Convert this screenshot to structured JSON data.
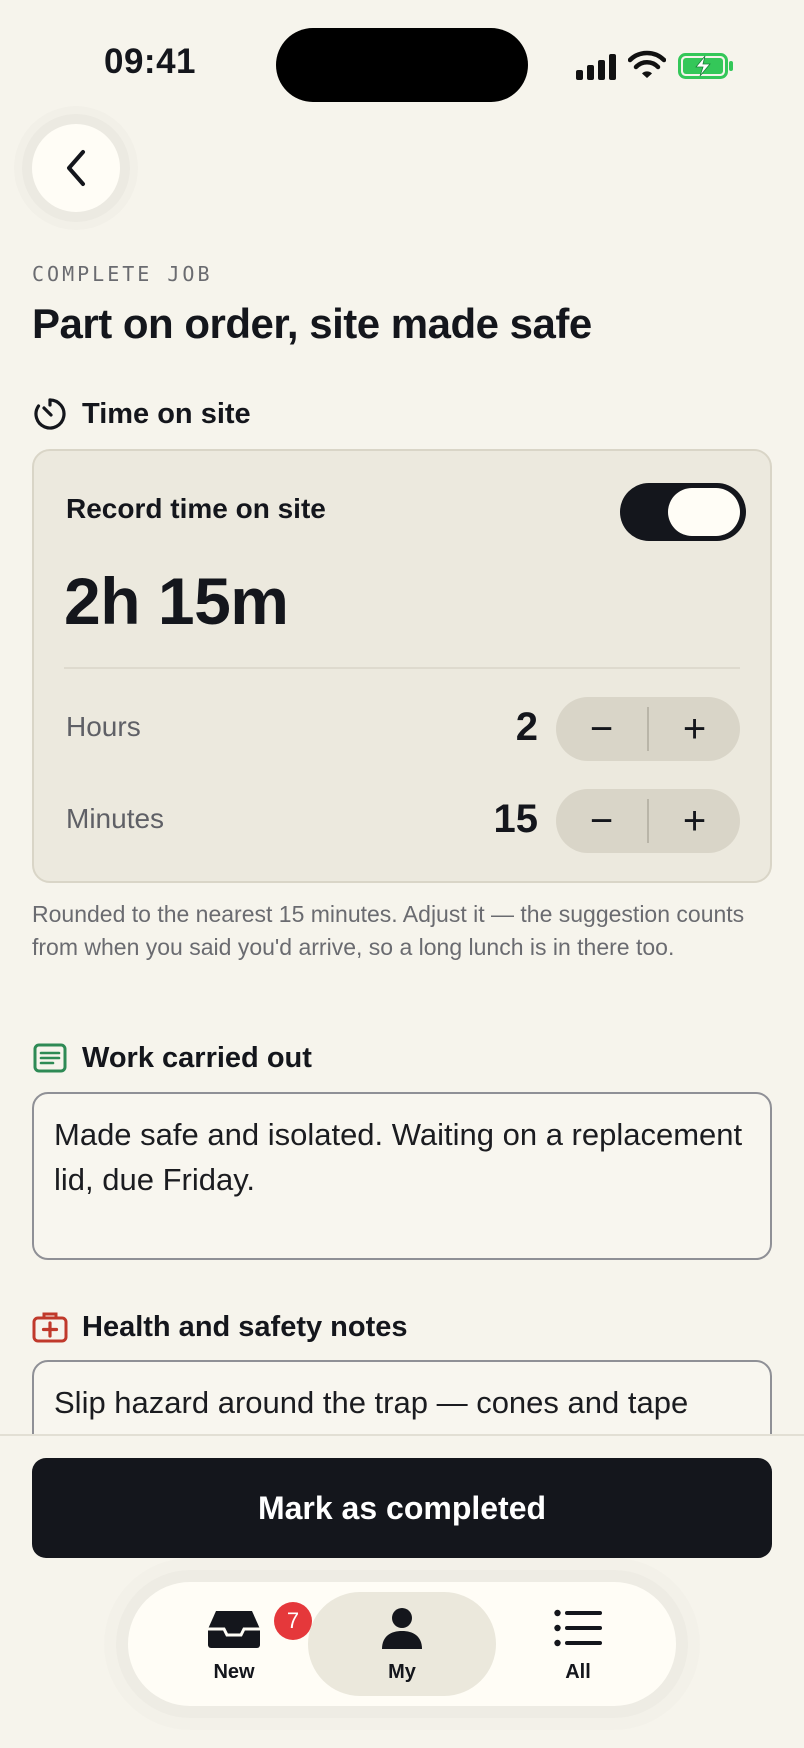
{
  "status_bar": {
    "time": "09:41"
  },
  "header": {
    "eyebrow": "COMPLETE JOB",
    "title": "Part on order, site made safe"
  },
  "time_on_site": {
    "heading": "Time on site",
    "record_label": "Record time on site",
    "record_enabled": true,
    "total": "2h 15m",
    "hours_label": "Hours",
    "hours_value": "2",
    "minutes_label": "Minutes",
    "minutes_value": "15",
    "decrement": "−",
    "increment": "+",
    "helper": "Rounded to the nearest 15 minutes. Adjust it — the suggestion counts from when you said you'd arrive, so a long lunch is in there too."
  },
  "work_carried_out": {
    "heading": "Work carried out",
    "value": "Made safe and isolated. Waiting on a replacement lid, due Friday."
  },
  "health_safety": {
    "heading": "Health and safety notes",
    "value": "Slip hazard around the trap — cones and tape"
  },
  "actions": {
    "primary": "Mark as completed"
  },
  "tabbar": {
    "new_label": "New",
    "new_badge": "7",
    "my_label": "My",
    "all_label": "All"
  },
  "colors": {
    "background": "#f6f4ec",
    "card": "#ece9de",
    "dark": "#14161c",
    "badge": "#e5383b",
    "work_icon": "#2e8a55",
    "safety_icon": "#c0392b",
    "battery": "#34c759"
  },
  "icons": {
    "back": "chevron-left-icon",
    "time": "timer-icon",
    "work": "notes-icon",
    "safety": "first-aid-kit-icon",
    "new": "inbox-tray-icon",
    "my": "person-icon",
    "all": "list-icon"
  }
}
